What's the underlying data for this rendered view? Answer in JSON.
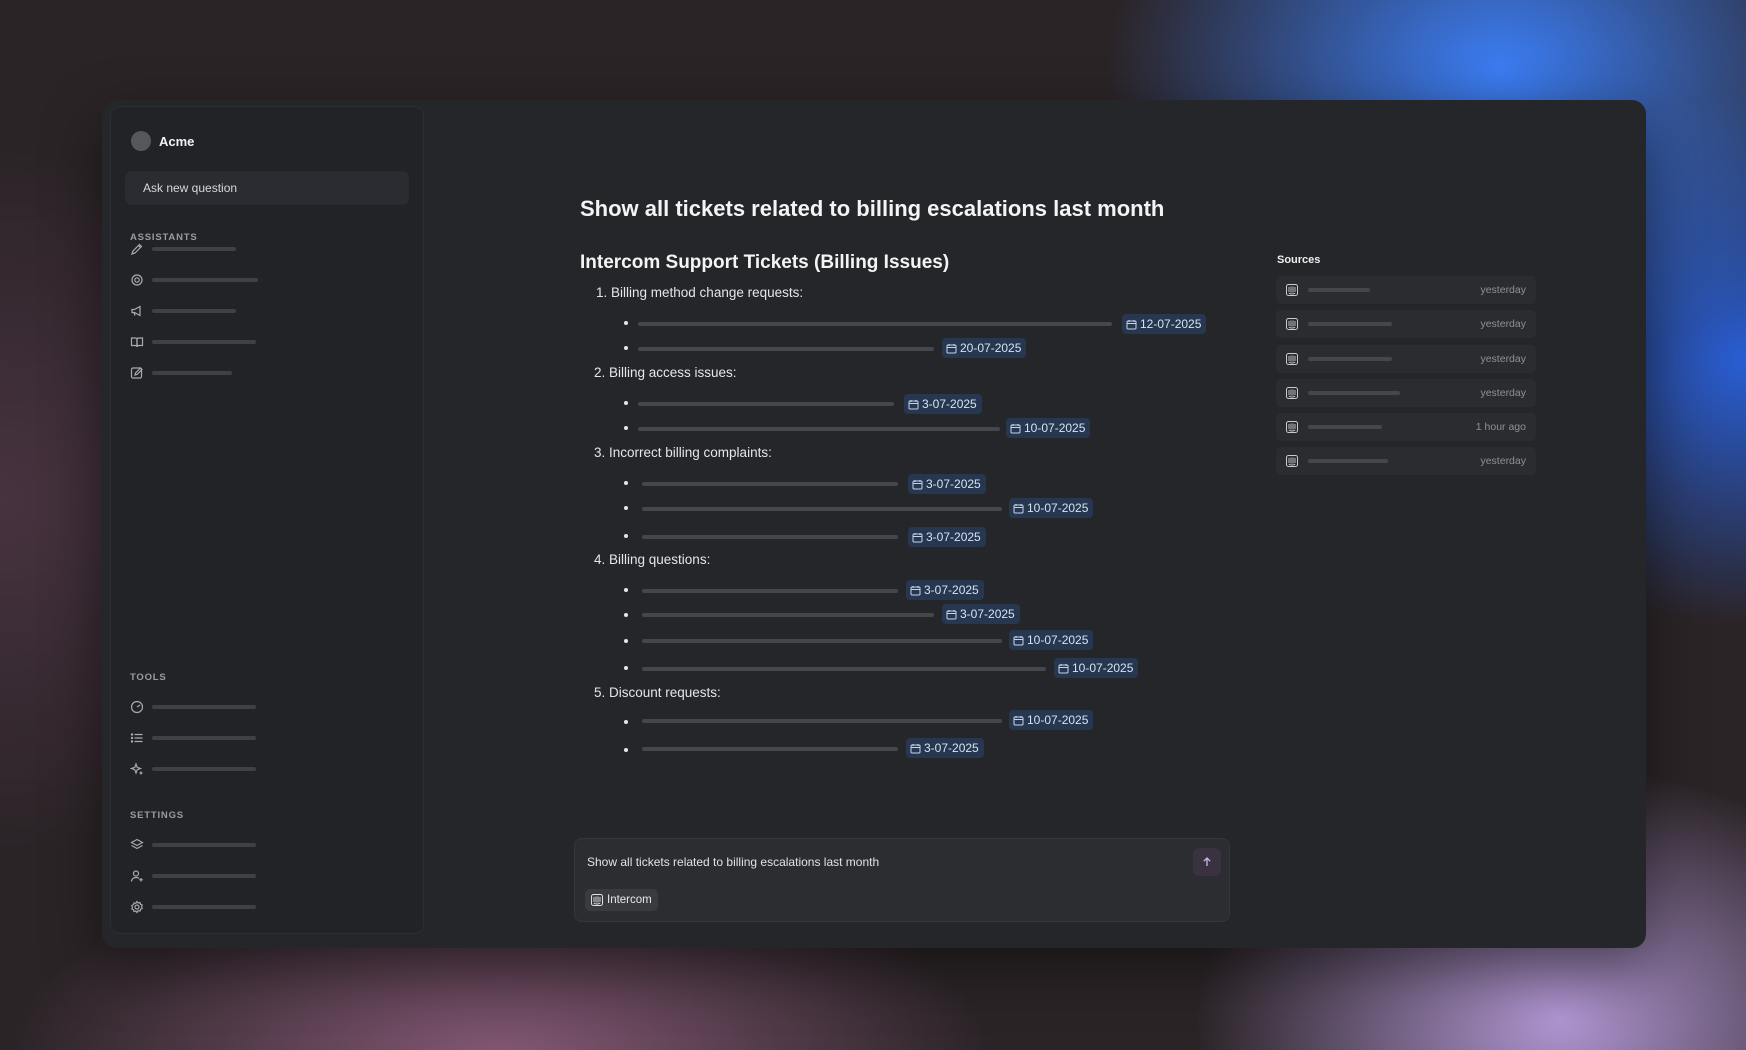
{
  "sidebar": {
    "brand": "Acme",
    "ask_button": "Ask new question",
    "assistants_title": "ASSISTANTS",
    "assistants": [
      {
        "icon": "pencil-icon"
      },
      {
        "icon": "gear-icon"
      },
      {
        "icon": "megaphone-icon"
      },
      {
        "icon": "book-icon"
      },
      {
        "icon": "edit-icon"
      }
    ],
    "tools_title": "TOOLS",
    "tools": [
      {
        "icon": "gauge-icon"
      },
      {
        "icon": "list-icon"
      },
      {
        "icon": "sparkle-icon"
      }
    ],
    "settings_title": "SETTINGS",
    "settings": [
      {
        "icon": "layers-icon"
      },
      {
        "icon": "user-add-icon"
      },
      {
        "icon": "settings-icon"
      }
    ]
  },
  "question": "Show all tickets related to billing escalations last month",
  "answer": {
    "heading": "Intercom Support Tickets (Billing Issues)",
    "groups": [
      {
        "label": "1. Billing method change requests:",
        "items": [
          {
            "date": "12-07-2025"
          },
          {
            "date": "20-07-2025"
          }
        ]
      },
      {
        "label": "2. Billing access issues:",
        "items": [
          {
            "date": "3-07-2025"
          },
          {
            "date": "10-07-2025"
          }
        ]
      },
      {
        "label": "3. Incorrect billing complaints:",
        "items": [
          {
            "date": "3-07-2025"
          },
          {
            "date": "10-07-2025"
          },
          {
            "date": "3-07-2025"
          }
        ]
      },
      {
        "label": "4. Billing questions:",
        "items": [
          {
            "date": "3-07-2025"
          },
          {
            "date": "3-07-2025"
          },
          {
            "date": "10-07-2025"
          },
          {
            "date": "10-07-2025"
          }
        ]
      },
      {
        "label": "5. Discount requests:",
        "items": [
          {
            "date": "10-07-2025"
          },
          {
            "date": "3-07-2025"
          }
        ]
      }
    ]
  },
  "sources": {
    "title": "Sources",
    "items": [
      {
        "icon": "intercom-icon",
        "time": "yesterday"
      },
      {
        "icon": "intercom-icon",
        "time": "yesterday"
      },
      {
        "icon": "intercom-icon",
        "time": "yesterday"
      },
      {
        "icon": "intercom-icon",
        "time": "yesterday"
      },
      {
        "icon": "intercom-icon",
        "time": "1 hour ago"
      },
      {
        "icon": "intercom-icon",
        "time": "yesterday"
      }
    ]
  },
  "composer": {
    "text": "Show all tickets related to billing escalations last month",
    "integration": "Intercom",
    "send_icon": "arrow-up-icon"
  },
  "colors": {
    "window": "#24262a",
    "chip_bg": "#27374f",
    "accent_blue": "#3c82ff"
  }
}
